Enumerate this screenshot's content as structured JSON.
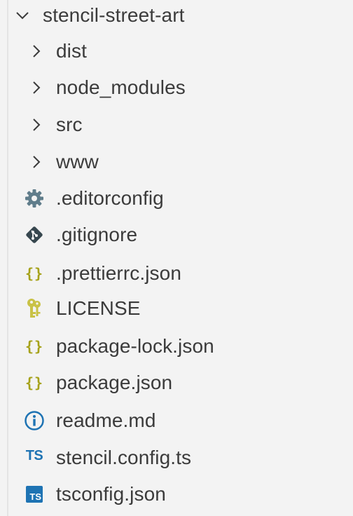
{
  "explorer": {
    "root": {
      "label": "stencil-street-art",
      "expanded": true
    },
    "folders": [
      {
        "label": "dist",
        "expanded": false
      },
      {
        "label": "node_modules",
        "expanded": false
      },
      {
        "label": "src",
        "expanded": false
      },
      {
        "label": "www",
        "expanded": false
      }
    ],
    "files": [
      {
        "label": ".editorconfig",
        "icon": "gear-icon",
        "icon_color": "#607d8b"
      },
      {
        "label": ".gitignore",
        "icon": "git-icon",
        "icon_color": "#37474f"
      },
      {
        "label": ".prettierrc.json",
        "icon": "json-braces-icon",
        "icon_text": "{}",
        "icon_color": "#a6a21a"
      },
      {
        "label": "LICENSE",
        "icon": "license-key-icon",
        "icon_color": "#c9c246"
      },
      {
        "label": "package-lock.json",
        "icon": "json-braces-icon",
        "icon_text": "{}",
        "icon_color": "#a6a21a"
      },
      {
        "label": "package.json",
        "icon": "json-braces-icon",
        "icon_text": "{}",
        "icon_color": "#a6a21a"
      },
      {
        "label": "readme.md",
        "icon": "info-icon",
        "icon_color": "#1e73b3"
      },
      {
        "label": "stencil.config.ts",
        "icon": "typescript-icon",
        "icon_text": "TS",
        "icon_color": "#1e73b3"
      },
      {
        "label": "tsconfig.json",
        "icon": "tsconfig-icon",
        "icon_text": "TS",
        "icon_color": "#1e73b3"
      }
    ]
  }
}
